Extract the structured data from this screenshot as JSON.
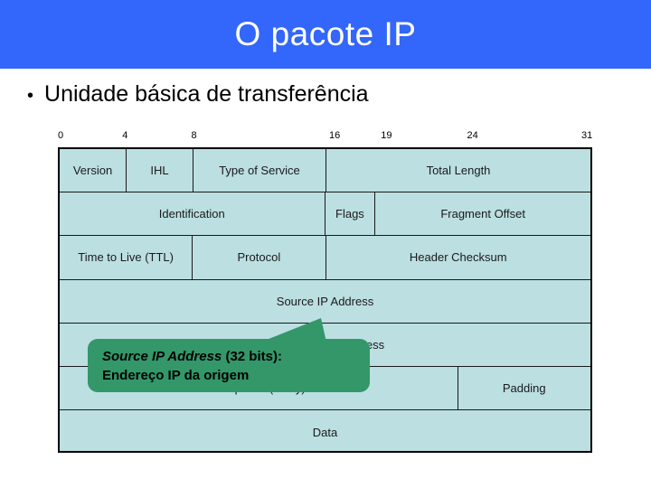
{
  "slide": {
    "title": "O pacote IP",
    "bullet_marker": "•",
    "bullet_text": "Unidade básica de transferência",
    "title_bg_color": "#3366fa",
    "title_text_color": "#ffffff",
    "table_cell_color": "#bcdfe1",
    "callout_color": "#33976a"
  },
  "bit_ruler": {
    "ticks": [
      {
        "label": "0",
        "bit": 0
      },
      {
        "label": "4",
        "bit": 4
      },
      {
        "label": "8",
        "bit": 8
      },
      {
        "label": "16",
        "bit": 16
      },
      {
        "label": "19",
        "bit": 19
      },
      {
        "label": "24",
        "bit": 24
      },
      {
        "label": "31",
        "bit": 31
      }
    ]
  },
  "packet_table": {
    "rows": [
      {
        "cells": [
          {
            "label": "Version",
            "bits": 4
          },
          {
            "label": "IHL",
            "bits": 4
          },
          {
            "label": "Type of Service",
            "bits": 8
          },
          {
            "label": "Total Length",
            "bits": 16
          }
        ]
      },
      {
        "cells": [
          {
            "label": "Identification",
            "bits": 16
          },
          {
            "label": "Flags",
            "bits": 3
          },
          {
            "label": "Fragment Offset",
            "bits": 13
          }
        ]
      },
      {
        "cells": [
          {
            "label": "Time to Live (TTL)",
            "bits": 8
          },
          {
            "label": "Protocol",
            "bits": 8
          },
          {
            "label": "Header Checksum",
            "bits": 16
          }
        ]
      },
      {
        "cells": [
          {
            "label": "Source IP Address",
            "bits": 32
          }
        ]
      },
      {
        "cells": [
          {
            "label": "Destination IP Address",
            "bits": 32
          }
        ]
      },
      {
        "cells": [
          {
            "label": "IP Options (if any)",
            "bits": 24
          },
          {
            "label": "Padding",
            "bits": 8
          }
        ]
      },
      {
        "cells": [
          {
            "label": "Data",
            "bits": 32
          }
        ]
      }
    ]
  },
  "callout": {
    "line1_emphasis": "Source IP Address",
    "line1_rest": " (32 bits):",
    "line2": "Endereço IP da origem"
  }
}
